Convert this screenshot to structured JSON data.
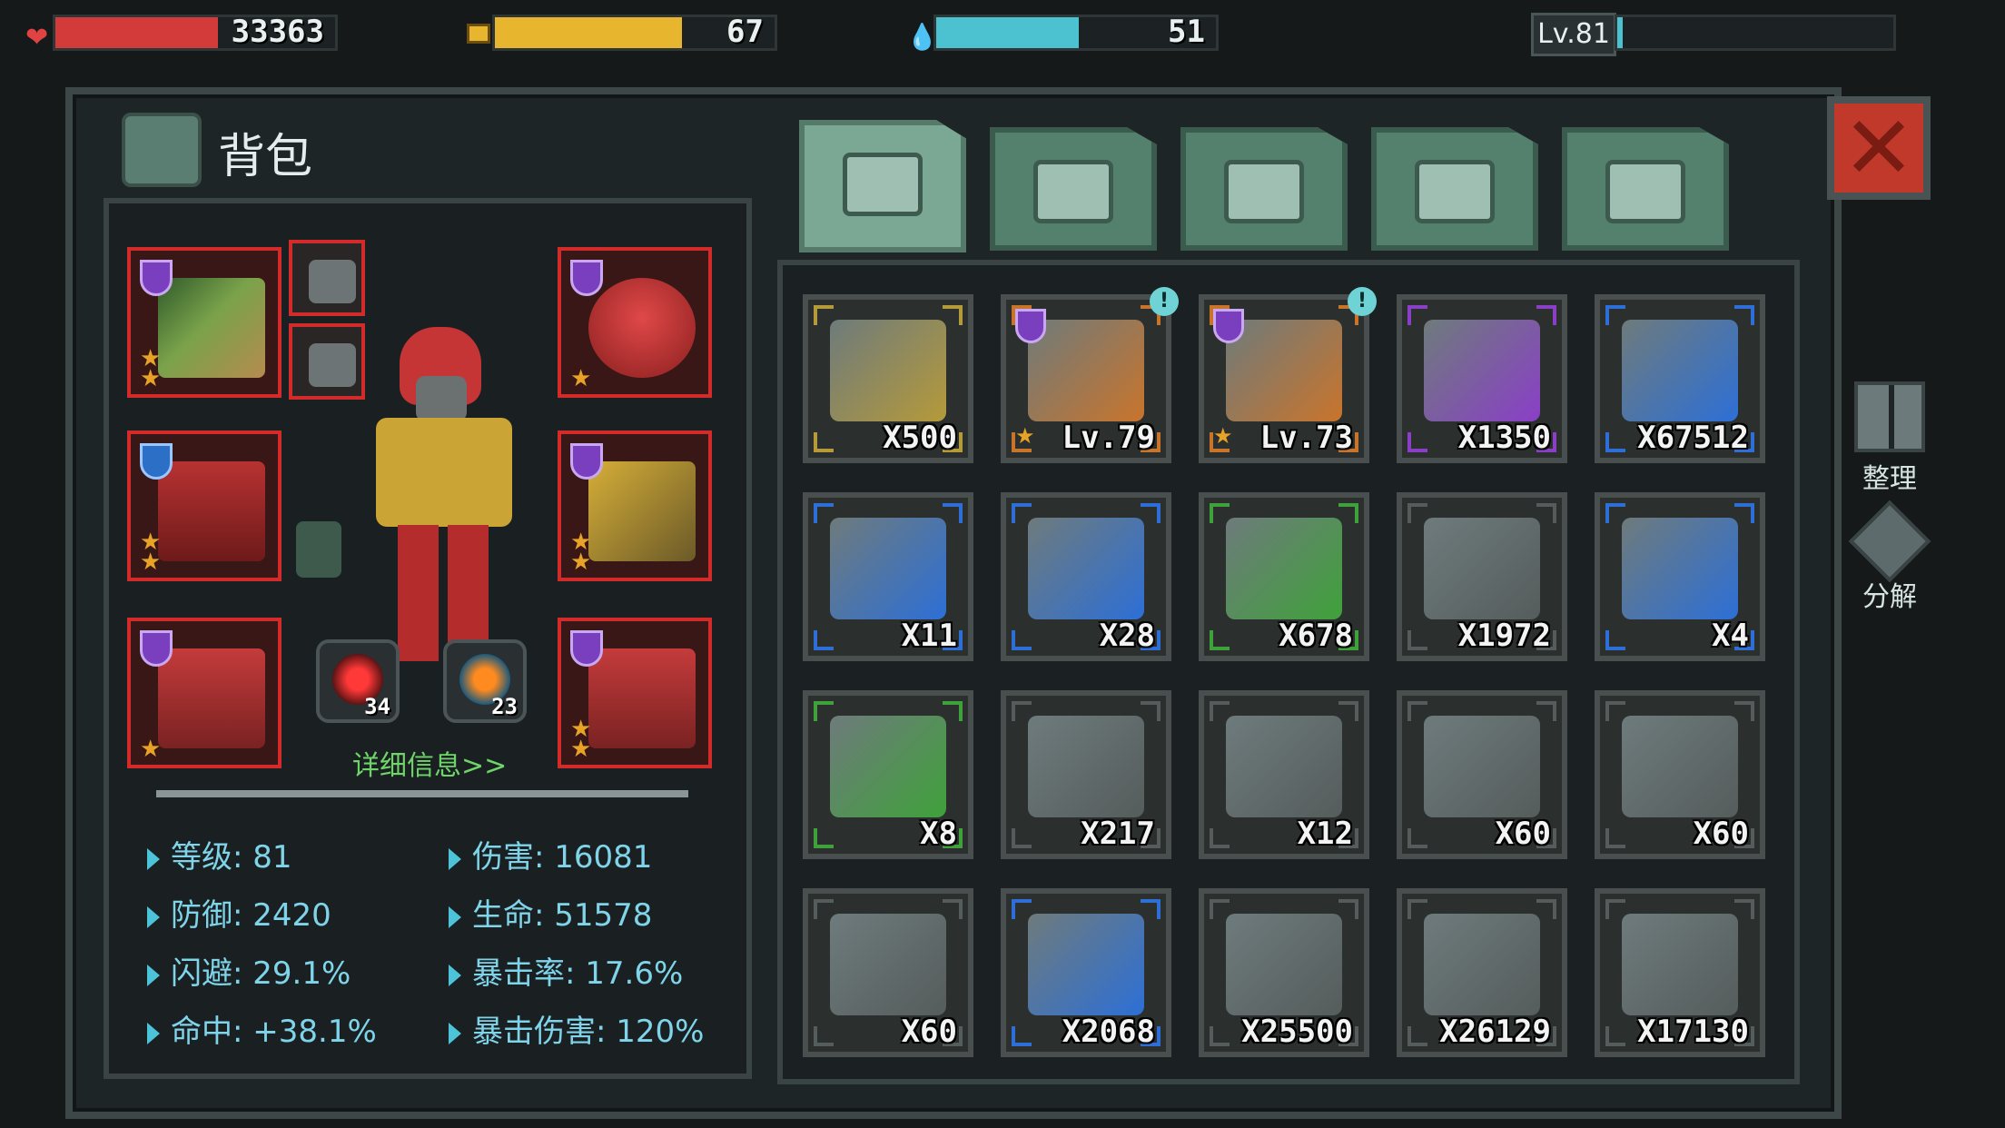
{
  "status": {
    "hp": {
      "value": "33363",
      "fill": 0.58,
      "color": "#d33a3a"
    },
    "food": {
      "value": "67",
      "fill": 0.67,
      "color": "#e8b52e"
    },
    "water": {
      "value": "51",
      "fill": 0.51,
      "color": "#4cc1cf"
    },
    "level": {
      "label": "Lv.81",
      "fill": 0.02,
      "color": "#4cc1cf"
    }
  },
  "panel": {
    "title": "背包",
    "details_link": "详细信息>>"
  },
  "tabs": [
    {
      "name": "backpack",
      "icon": "backpack-icon",
      "active": true
    },
    {
      "name": "medical",
      "icon": "medkit-icon",
      "active": false
    },
    {
      "name": "materials",
      "icon": "materials-icon",
      "active": false
    },
    {
      "name": "weapons",
      "icon": "pistol-icon",
      "active": false
    },
    {
      "name": "tools",
      "icon": "wrench-icon",
      "active": false
    }
  ],
  "equipment": {
    "cores": [
      {
        "value": "34"
      },
      {
        "value": "23"
      }
    ]
  },
  "stats": [
    {
      "label": "等级: 81"
    },
    {
      "label": "伤害: 16081"
    },
    {
      "label": "防御: 2420"
    },
    {
      "label": "生命: 51578"
    },
    {
      "label": "闪避: 29.1%"
    },
    {
      "label": "暴击率: 17.6%"
    },
    {
      "label": "命中: +38.1%"
    },
    {
      "label": "暴击伤害: 120%"
    }
  ],
  "inventory": [
    {
      "qty": "X500",
      "rarity": "#b59a3a",
      "icon": "exp-badge-icon"
    },
    {
      "qty": "Lv.79",
      "rarity": "#c9742b",
      "icon": "crossbow-icon",
      "badge": "!"
    },
    {
      "qty": "Lv.73",
      "rarity": "#c9742b",
      "icon": "shotgun-icon",
      "badge": "!"
    },
    {
      "qty": "X1350",
      "rarity": "#8a3fc7",
      "icon": "gold-coin-icon"
    },
    {
      "qty": "X67512",
      "rarity": "#2d6fd6",
      "icon": "silver-coin-icon"
    },
    {
      "qty": "X11",
      "rarity": "#2d6fd6",
      "icon": "map-icon"
    },
    {
      "qty": "X28",
      "rarity": "#2d6fd6",
      "icon": "armor-crate-blue-icon"
    },
    {
      "qty": "X678",
      "rarity": "#3fa13a",
      "icon": "armor-crate-green-icon"
    },
    {
      "qty": "X1972",
      "rarity": "#555c5c",
      "icon": "armor-crate-grey-icon"
    },
    {
      "qty": "X4",
      "rarity": "#2d6fd6",
      "icon": "wrench-blue-icon"
    },
    {
      "qty": "X8",
      "rarity": "#3fa13a",
      "icon": "wrench-green-icon"
    },
    {
      "qty": "X217",
      "rarity": "#555c5c",
      "icon": "wrench-grey-icon"
    },
    {
      "qty": "X12",
      "rarity": "#555c5c",
      "icon": "vest-purple-icon"
    },
    {
      "qty": "X60",
      "rarity": "#555c5c",
      "icon": "pistol-purple-icon"
    },
    {
      "qty": "X60",
      "rarity": "#555c5c",
      "icon": "vest-blue-icon"
    },
    {
      "qty": "X60",
      "rarity": "#555c5c",
      "icon": "pistol-blue-icon"
    },
    {
      "qty": "X2068",
      "rarity": "#2d6fd6",
      "icon": "magazine-icon"
    },
    {
      "qty": "X25500",
      "rarity": "#555c5c",
      "icon": "ammo-box-icon"
    },
    {
      "qty": "X26129",
      "rarity": "#555c5c",
      "icon": "ammo-crate-icon"
    },
    {
      "qty": "X17130",
      "rarity": "#555c5c",
      "icon": "arrows-quiver-icon"
    }
  ],
  "side_actions": [
    {
      "label": "整理",
      "icon": "sort-icon"
    },
    {
      "label": "分解",
      "icon": "dismantle-icon"
    }
  ]
}
